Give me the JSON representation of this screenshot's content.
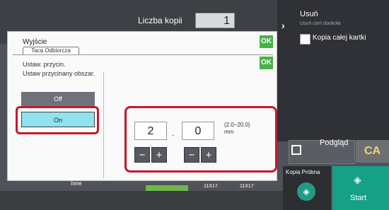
{
  "header": {
    "copies_label": "Liczba kopii",
    "copies_value": "1"
  },
  "right_panel": {
    "usun_title": "Usuń",
    "usun_subtitle": "Usuń cień dookoła",
    "copy_whole_label": "Kopia całej kartki"
  },
  "actions": {
    "preview_label": "Podgląd",
    "ca_label": "CA",
    "proof_copy_label": "Kopia Próbna",
    "start_label": "Start"
  },
  "bottom": {
    "other_label": "Inne",
    "size1": "11X17",
    "size2": "11X17"
  },
  "dialog": {
    "title": "Wyjście",
    "tab": "Taca Odbiorcza",
    "ok_label": "OK",
    "instruction1": "Ustaw. przycin.",
    "instruction2": "Ustaw przycinany obszar.",
    "off_label": "Off",
    "on_label": "On",
    "value_integer": "2",
    "value_decimal": "0",
    "separator": ".",
    "range_line1": "(2.0~20.0)",
    "range_line2": "mm",
    "minus": "−",
    "plus": "+"
  },
  "icons": {
    "chevron": "chevron-right-icon",
    "preview": "preview-magnifier-icon",
    "start": "diamond-start-icon"
  },
  "colors": {
    "ok_green": "#45b347",
    "highlight_red": "#c5182d",
    "on_cyan": "#8ee3ec",
    "start_teal": "#16a086"
  }
}
